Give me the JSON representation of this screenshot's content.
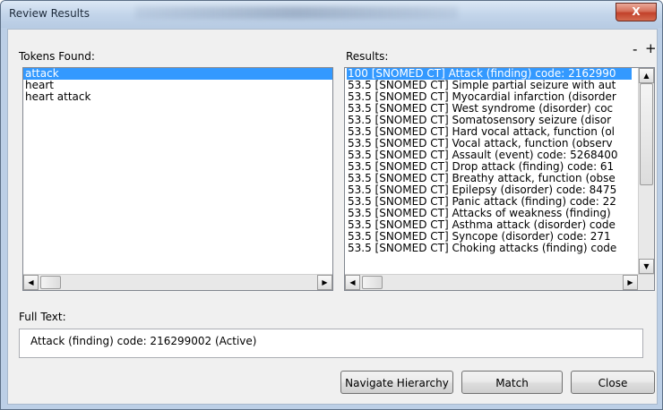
{
  "window": {
    "title": "Review Results",
    "close_glyph": "X"
  },
  "tokens": {
    "label": "Tokens Found:",
    "items": [
      "attack",
      "heart",
      "heart attack"
    ]
  },
  "results": {
    "label": "Results:",
    "minus": "-",
    "plus": "+",
    "items": [
      "100 [SNOMED CT] Attack (finding) code: 2162990",
      "53.5 [SNOMED CT] Simple partial seizure with aut",
      "53.5 [SNOMED CT] Myocardial infarction (disorder",
      "53.5 [SNOMED CT] West syndrome (disorder) coc",
      "53.5 [SNOMED CT] Somatosensory seizure (disor",
      "53.5 [SNOMED CT] Hard vocal attack, function (ol",
      "53.5 [SNOMED CT] Vocal attack, function (observ",
      "53.5 [SNOMED CT] Assault (event) code: 5268400",
      "53.5 [SNOMED CT] Drop attack (finding) code: 61",
      "53.5 [SNOMED CT] Breathy attack, function (obse",
      "53.5 [SNOMED CT] Epilepsy (disorder) code: 8475",
      "53.5 [SNOMED CT] Panic attack (finding) code: 22",
      "53.5 [SNOMED CT] Attacks of weakness (finding)",
      "53.5 [SNOMED CT] Asthma attack (disorder) code",
      "53.5 [SNOMED CT] Syncope (disorder) code: 271",
      "53.5 [SNOMED CT] Choking attacks (finding) code"
    ]
  },
  "full_text": {
    "label": "Full Text:",
    "value": "Attack (finding) code: 216299002 (Active)"
  },
  "buttons": {
    "navigate": "Navigate Hierarchy",
    "match": "Match",
    "close": "Close"
  },
  "icons": {
    "close": "close-icon",
    "scroll_left": "arrow-left-icon",
    "scroll_right": "arrow-right-icon",
    "scroll_up": "arrow-up-icon",
    "scroll_down": "arrow-down-icon"
  }
}
